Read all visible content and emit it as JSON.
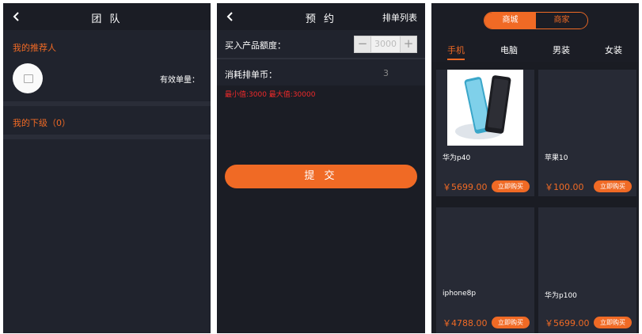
{
  "team_screen": {
    "title": "团 队",
    "referrer_label": "我的推荐人",
    "valid_orders_label": "有效单量：",
    "subordinates_label": "我的下级（0）"
  },
  "reserve_screen": {
    "title": "预 约",
    "right_link": "排单列表",
    "amount_label": "买入产品额度：",
    "amount_value": "3000",
    "minus": "−",
    "plus": "+",
    "consume_label": "消耗排单币：",
    "consume_value": "3",
    "range_text": "最小值:3000 最大值:30000",
    "submit_label": "提 交"
  },
  "shop_screen": {
    "segments": [
      "商城",
      "商家"
    ],
    "tabs": [
      "手机",
      "电脑",
      "男装",
      "女装"
    ],
    "buy_label": "立即购买",
    "products": [
      {
        "name": "华为p40",
        "price": "￥5699.00"
      },
      {
        "name": "苹果10",
        "price": "￥100.00"
      },
      {
        "name": "iphone8p",
        "price": "￥4788.00"
      },
      {
        "name": "华为p100",
        "price": "￥5699.00"
      }
    ]
  },
  "colors": {
    "accent": "#f06a25",
    "background": "#20232d",
    "header": "#1b1d25",
    "error": "#f02a2a"
  }
}
